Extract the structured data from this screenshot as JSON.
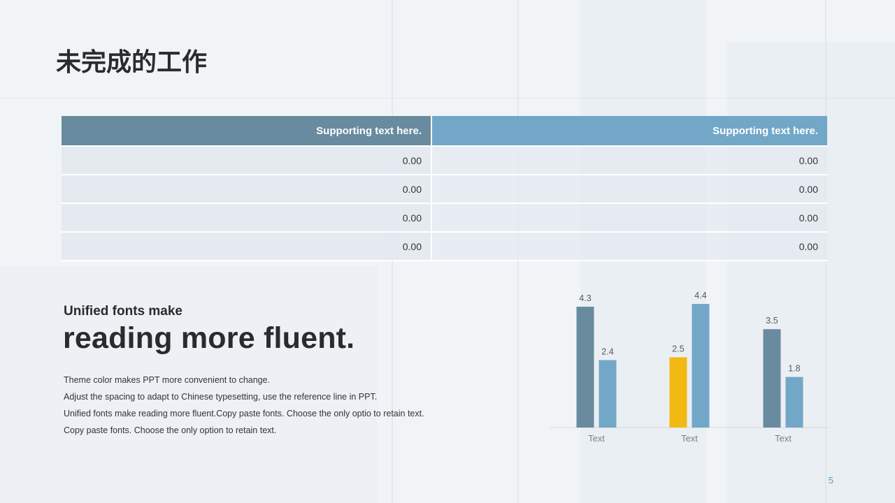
{
  "title": "未完成的工作",
  "table": {
    "headers": [
      "Supporting text here.",
      "Supporting text here."
    ],
    "rows": [
      [
        "0.00",
        "0.00"
      ],
      [
        "0.00",
        "0.00"
      ],
      [
        "0.00",
        "0.00"
      ],
      [
        "0.00",
        "0.00"
      ]
    ]
  },
  "text_block": {
    "subheading": "Unified fonts make",
    "heading": "reading more fluent.",
    "lines": [
      "Theme color makes PPT more convenient  to change.",
      "Adjust  the spacing  to adapt to Chinese  typesetting,  use the reference line  in  PPT.",
      "Unified  fonts make reading more fluent.Copy paste fonts. Choose the only optio to retain text.",
      "Copy paste  fonts. Choose the only option to retain text."
    ]
  },
  "chart_data": {
    "type": "bar",
    "categories": [
      "Text",
      "Text",
      "Text"
    ],
    "series": [
      {
        "values": [
          4.3,
          2.5,
          3.5
        ]
      },
      {
        "values": [
          2.4,
          4.4,
          1.8
        ]
      }
    ],
    "value_labels": [
      [
        "4.3",
        "2.5",
        "3.5"
      ],
      [
        "2.4",
        "4.4",
        "1.8"
      ]
    ],
    "bar_colors": [
      [
        "#688b9f",
        "#f2b912",
        "#688b9f"
      ],
      [
        "#72a7c7",
        "#72a7c7",
        "#72a7c7"
      ]
    ],
    "ylim": [
      0,
      4.4
    ],
    "grid": false,
    "legend": "none"
  },
  "page_number": "5"
}
